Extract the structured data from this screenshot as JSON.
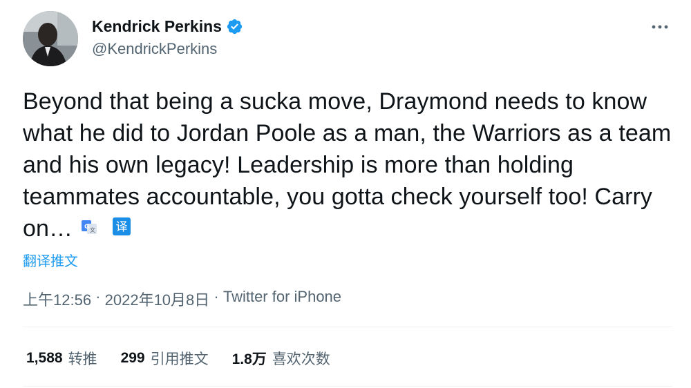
{
  "author": {
    "name": "Kendrick Perkins",
    "handle": "@KendrickPerkins",
    "verified": true,
    "verified_color": "#1d9bf0"
  },
  "tweet": {
    "text": "Beyond that being a sucka move, Draymond needs to know what he did to Jordan Poole as a man, the Warriors as a team and his own legacy! Leadership is more than holding teammates accountable, you gotta check yourself too! Carry on…",
    "translate_label": "翻译推文",
    "inline_icons": [
      "google-translate-icon",
      "translate-badge-icon"
    ],
    "translate_badge_glyph": "译"
  },
  "meta": {
    "time": "上午12:56",
    "separator": " · ",
    "date": "2022年10月8日",
    "source": "Twitter for iPhone"
  },
  "stats": [
    {
      "value": "1,588",
      "label": "转推"
    },
    {
      "value": "299",
      "label": "引用推文"
    },
    {
      "value": "1.8万",
      "label": "喜欢次数"
    }
  ],
  "icons": {
    "more": "more-options-icon",
    "verified": "verified-badge-icon",
    "avatar": "avatar"
  },
  "colors": {
    "text": "#0f1419",
    "secondary": "#536471",
    "accent": "#1d9bf0",
    "divider": "#eff3f4"
  }
}
